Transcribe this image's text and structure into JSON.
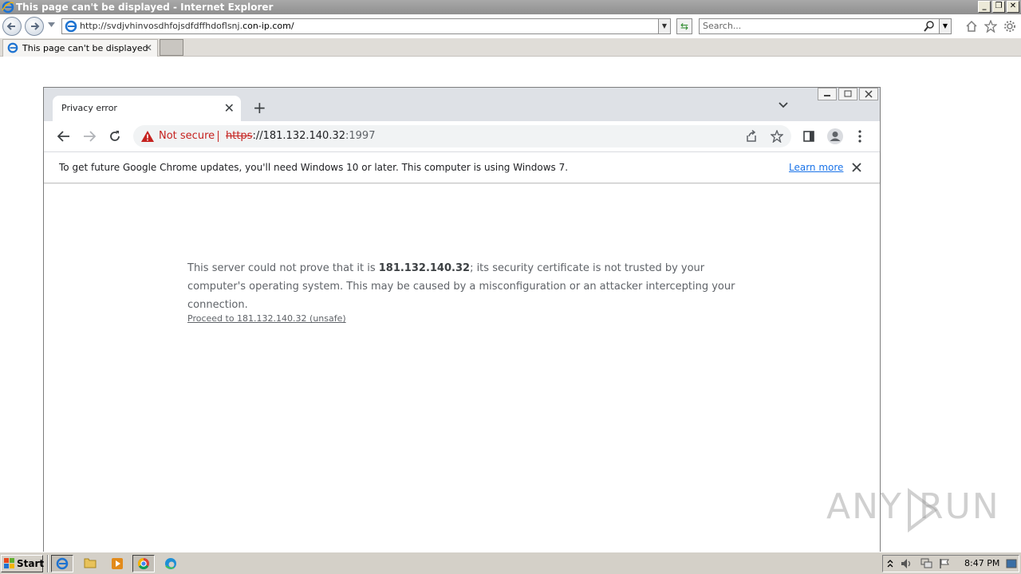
{
  "ie": {
    "window_title": "This page can't be displayed - Internet Explorer",
    "address_prefix": "http://svdjvhinvosdhfojsdfdffhdoflsnj.",
    "address_host": "con-ip.com/",
    "search_placeholder": "Search...",
    "tab_label": "This page can't be displayed",
    "tab_close": "✕"
  },
  "chrome": {
    "tab_title": "Privacy error",
    "tab_close": "✕",
    "new_tab": "+",
    "security_label": "Not secure",
    "url_scheme": "https",
    "url_sep": "://",
    "url_host": "181.132.140.32",
    "url_port": ":1997",
    "infobar_text": "To get future Google Chrome updates, you'll need Windows 10 or later. This computer is using Windows 7.",
    "infobar_link": "Learn more"
  },
  "page": {
    "error_text_before": "This server could not prove that it is ",
    "error_host": "181.132.140.32",
    "error_text_after": "; its security certificate is not trusted by your computer's operating system. This may be caused by a misconfiguration or an attacker intercepting your connection.",
    "proceed_link": "Proceed to 181.132.140.32 (unsafe)"
  },
  "watermark": {
    "left": "ANY",
    "right": "RUN"
  },
  "taskbar": {
    "start_label": "Start",
    "clock": "8:47 PM"
  },
  "colors": {
    "chrome_frame": "#dee1e6",
    "not_secure_red": "#c5221f",
    "link_blue": "#1a73e8"
  }
}
